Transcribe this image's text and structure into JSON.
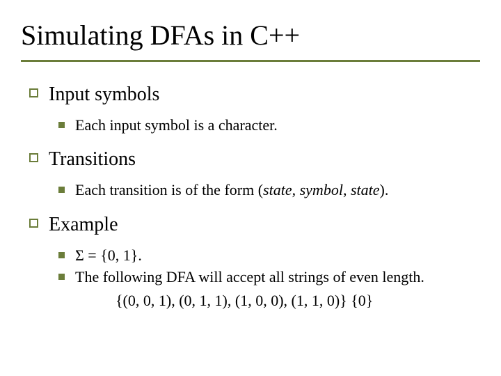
{
  "title": "Simulating DFAs in C++",
  "sections": [
    {
      "heading": "Input symbols",
      "items": [
        {
          "plain": "Each input symbol is a character."
        }
      ]
    },
    {
      "heading": "Transitions",
      "items": [
        {
          "prefix": "Each transition is of the form (",
          "i1": "state",
          "mid1": ", ",
          "i2": "symbol",
          "mid2": ", ",
          "i3": "state",
          "suffix": ")."
        }
      ]
    },
    {
      "heading": "Example",
      "items": [
        {
          "plain": "Σ = {0, 1}."
        },
        {
          "plain": "The following DFA will accept all strings of even length."
        }
      ],
      "continuation": "{(0, 0, 1), (0, 1, 1), (1, 0, 0), (1, 1, 0)} {0}"
    }
  ]
}
